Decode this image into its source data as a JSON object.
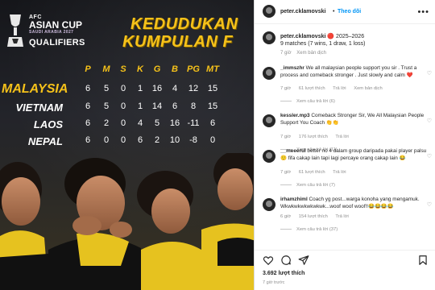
{
  "graphic": {
    "logo": {
      "line1": "AFC",
      "line2": "ASIAN CUP",
      "line3": "SAUDI ARABIA 2027",
      "line4": "QUALIFIERS"
    },
    "title_line1": "KEDUDUKAN",
    "title_line2": "KUMPULAN F",
    "headers": [
      "P",
      "M",
      "S",
      "K",
      "G",
      "B",
      "PG",
      "MT"
    ],
    "rows": [
      {
        "team": "MALAYSIA",
        "values": [
          "6",
          "5",
          "0",
          "1",
          "16",
          "4",
          "12",
          "15"
        ]
      },
      {
        "team": "VIETNAM",
        "values": [
          "6",
          "5",
          "0",
          "1",
          "14",
          "6",
          "8",
          "15"
        ]
      },
      {
        "team": "LAOS",
        "values": [
          "6",
          "2",
          "0",
          "4",
          "5",
          "16",
          "-11",
          "6"
        ]
      },
      {
        "team": "NEPAL",
        "values": [
          "6",
          "0",
          "0",
          "6",
          "2",
          "10",
          "-8",
          "0"
        ]
      }
    ]
  },
  "post": {
    "username": "peter.cklamovski",
    "follow_separator": "•",
    "follow_label": "Theo dõi",
    "more_icon": "•••",
    "caption": {
      "username": "peter.cklamovski",
      "text": "🔴 2025–2026",
      "line2": "9 matches (7 wins, 1 draw, 1 loss)",
      "time": "7 giờ",
      "translate": "Xem bản dịch"
    },
    "comments": [
      {
        "username": "_immszhr",
        "text": "We all malaysian people support you sir . Trust a process and comeback stronger . Just slowly and calm ❤️",
        "time": "7 giờ",
        "likes": "61 lượt thích",
        "reply": "Trả lời",
        "translate": "Xem bản dịch",
        "view_replies": "Xem câu trả lời (6)"
      },
      {
        "username": "kessler.mp3",
        "text": "Comeback Stronger Sir, We All Malaysian People Support You Coach 👏👏",
        "time": "7 giờ",
        "likes": "176 lượt thích",
        "reply": "Trả lời",
        "translate": "",
        "view_replies": "Xem câu trả lời (11)"
      },
      {
        "username": "__meeerul",
        "text": "better no 4 dalam group daripada pakai player palsu 🙂 fifa cakap lain tapi lagi percaye orang cakap lain 😂",
        "time": "7 giờ",
        "likes": "61 lượt thích",
        "reply": "Trả lời",
        "translate": "",
        "view_replies": "Xem câu trả lời (7)"
      },
      {
        "username": "irhamzhiml",
        "text": "Coach yg post...warga konoha yang mengamuk. Wkwkwkwkwkwkwk...woof woof woof!!😂😂😂😂",
        "time": "6 giờ",
        "likes": "154 lượt thích",
        "reply": "Trả lời",
        "translate": "",
        "view_replies": "Xem câu trả lời (37)"
      }
    ],
    "likes": "3.692 lượt thích",
    "ago": "7 giờ trước"
  }
}
